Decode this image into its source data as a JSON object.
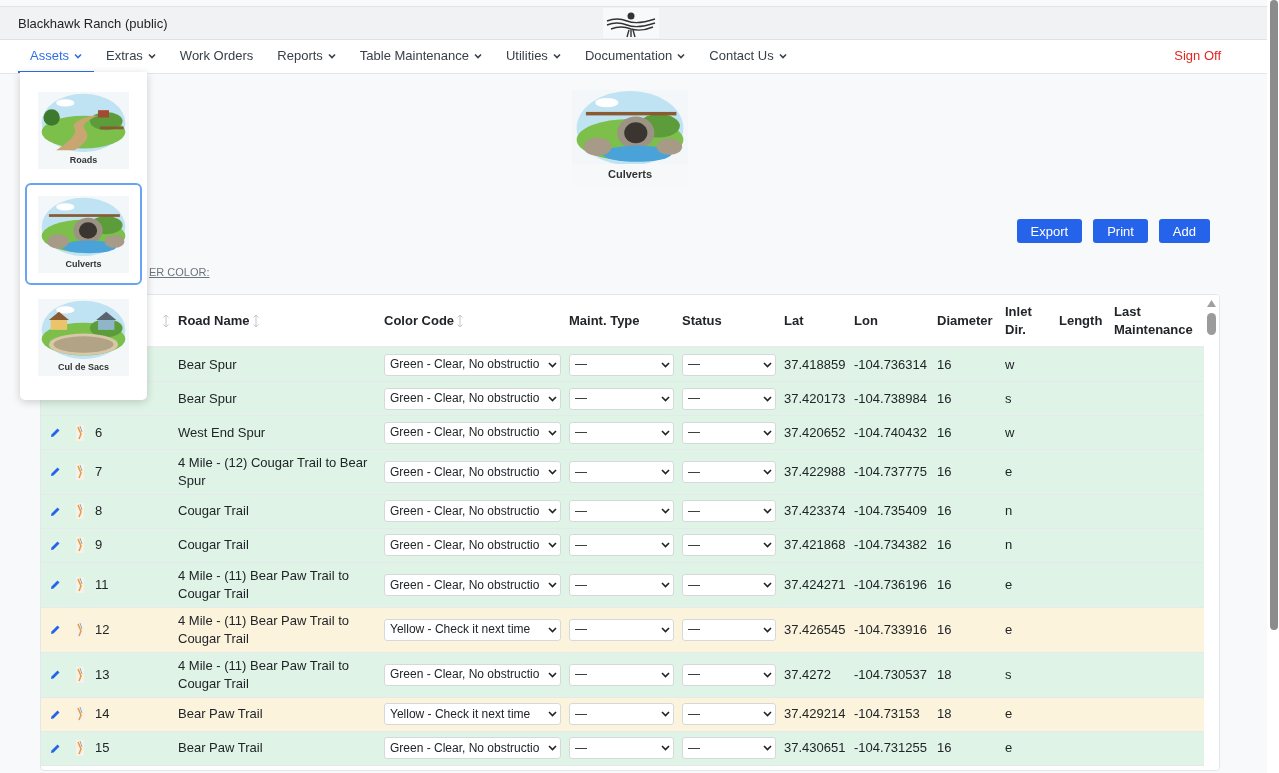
{
  "app": {
    "title": "Blackhawk Ranch (public)"
  },
  "nav": {
    "items": [
      {
        "label": "Assets",
        "has_menu": true,
        "selected": true
      },
      {
        "label": "Extras",
        "has_menu": true,
        "selected": false
      },
      {
        "label": "Work Orders",
        "has_menu": false,
        "selected": false
      },
      {
        "label": "Reports",
        "has_menu": true,
        "selected": false
      },
      {
        "label": "Table Maintenance",
        "has_menu": true,
        "selected": false
      },
      {
        "label": "Utilities",
        "has_menu": true,
        "selected": false
      },
      {
        "label": "Documentation",
        "has_menu": true,
        "selected": false
      },
      {
        "label": "Contact Us",
        "has_menu": true,
        "selected": false
      }
    ],
    "sign_off": "Sign Off"
  },
  "asset_menu": [
    {
      "label": "Roads",
      "kind": "road",
      "selected": false
    },
    {
      "label": "Culverts",
      "kind": "culvert",
      "selected": true
    },
    {
      "label": "Cul de Sacs",
      "kind": "cul",
      "selected": false
    }
  ],
  "page": {
    "caption": "Culverts",
    "buttons": [
      "Export",
      "Print",
      "Add"
    ],
    "filter_label": "ER COLOR:"
  },
  "table": {
    "columns": [
      {
        "sortable": true
      },
      {
        "label": "Road Name",
        "sortable": true
      },
      {
        "label": "Color Code",
        "sortable": true
      },
      {
        "label": "Maint. Type",
        "sortable": false
      },
      {
        "label": "Status",
        "sortable": false
      },
      {
        "label": "Lat",
        "sortable": false
      },
      {
        "label": "Lon",
        "sortable": false
      },
      {
        "label": "Diameter",
        "sortable": false
      },
      {
        "label": "Inlet Dir.",
        "sortable": false
      },
      {
        "label": "Length",
        "sortable": false
      },
      {
        "label": "Last Maintenance",
        "sortable": false
      }
    ],
    "rows": [
      {
        "road": "Bear Spur",
        "color_code": "Green - Clear, No obstructio",
        "color": "#dff4e6",
        "maint_type": "—",
        "status": "—",
        "lat": "37.418859",
        "lon": "-104.736314",
        "diameter": "16",
        "inlet": "w"
      },
      {
        "road": "Bear Spur",
        "color_code": "Green - Clear, No obstructio",
        "color": "#dff4e6",
        "maint_type": "—",
        "status": "—",
        "lat": "37.420173",
        "lon": "-104.738984",
        "diameter": "16",
        "inlet": "s"
      },
      {
        "id": "6",
        "road": "West End Spur",
        "color_code": "Green - Clear, No obstructio",
        "color": "#dff4e6",
        "maint_type": "—",
        "status": "—",
        "lat": "37.420652",
        "lon": "-104.740432",
        "diameter": "16",
        "inlet": "w"
      },
      {
        "id": "7",
        "road": "4 Mile - (12) Cougar Trail to Bear Spur",
        "color_code": "Green - Clear, No obstructio",
        "color": "#dff4e6",
        "maint_type": "—",
        "status": "—",
        "lat": "37.422988",
        "lon": "-104.737775",
        "diameter": "16",
        "inlet": "e"
      },
      {
        "id": "8",
        "road": "Cougar Trail",
        "color_code": "Green - Clear, No obstructio",
        "color": "#dff4e6",
        "maint_type": "—",
        "status": "—",
        "lat": "37.423374",
        "lon": "-104.735409",
        "diameter": "16",
        "inlet": "n"
      },
      {
        "id": "9",
        "road": "Cougar Trail",
        "color_code": "Green - Clear, No obstructio",
        "color": "#dff4e6",
        "maint_type": "—",
        "status": "—",
        "lat": "37.421868",
        "lon": "-104.734382",
        "diameter": "16",
        "inlet": "n"
      },
      {
        "id": "11",
        "road": "4 Mile - (11) Bear Paw Trail to Cougar Trail",
        "color_code": "Green - Clear, No obstructio",
        "color": "#dff4e6",
        "maint_type": "—",
        "status": "—",
        "lat": "37.424271",
        "lon": "-104.736196",
        "diameter": "16",
        "inlet": "e"
      },
      {
        "id": "12",
        "road": "4 Mile - (11) Bear Paw Trail to Cougar Trail",
        "color_code": "Yellow - Check it next time",
        "color": "#fcf3dc",
        "maint_type": "—",
        "status": "—",
        "lat": "37.426545",
        "lon": "-104.733916",
        "diameter": "16",
        "inlet": "e"
      },
      {
        "id": "13",
        "road": "4 Mile - (11) Bear Paw Trail to Cougar Trail",
        "color_code": "Green - Clear, No obstructio",
        "color": "#dff4e6",
        "maint_type": "—",
        "status": "—",
        "lat": "37.4272",
        "lon": "-104.730537",
        "diameter": "18",
        "inlet": "s"
      },
      {
        "id": "14",
        "road": "Bear Paw Trail",
        "color_code": "Yellow - Check it next time",
        "color": "#fcf3dc",
        "maint_type": "—",
        "status": "—",
        "lat": "37.429214",
        "lon": "-104.73153",
        "diameter": "18",
        "inlet": "e"
      },
      {
        "id": "15",
        "road": "Bear Paw Trail",
        "color_code": "Green - Clear, No obstructio",
        "color": "#dff4e6",
        "maint_type": "—",
        "status": "—",
        "lat": "37.430651",
        "lon": "-104.731255",
        "diameter": "16",
        "inlet": "e"
      }
    ]
  }
}
